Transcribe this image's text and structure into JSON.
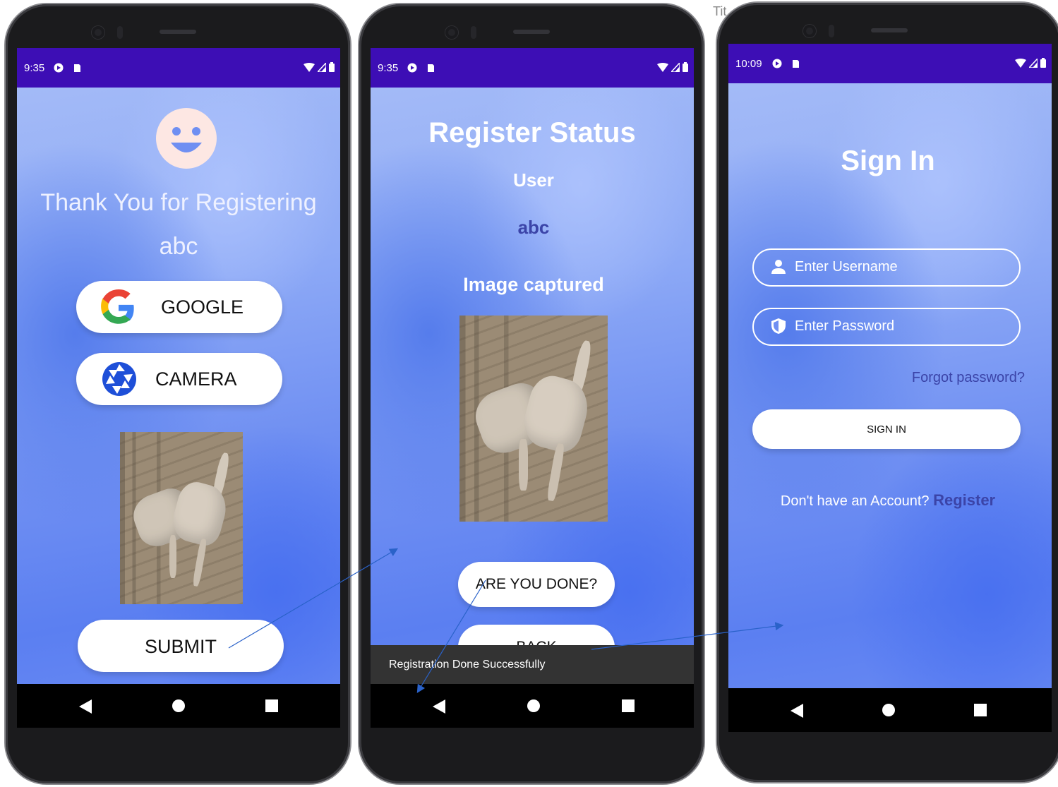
{
  "colors": {
    "status_bar": "#3d0eb5",
    "dark_accent": "#3b44a8",
    "pill_bg": "#ffffff",
    "snackbar_bg": "#333333"
  },
  "window_title_fragment": "Tit",
  "screen1": {
    "status": {
      "time": "9:35"
    },
    "smiley_icon": "smiley-face-icon",
    "thanks_text": "Thank You for Registering",
    "username": "abc",
    "google_button": "GOOGLE",
    "camera_button": "CAMERA",
    "submit_button": "SUBMIT"
  },
  "screen2": {
    "status": {
      "time": "9:35"
    },
    "title": "Register Status",
    "user_label": "User",
    "user_value": "abc",
    "image_label": "Image captured",
    "done_button": "ARE YOU DONE?",
    "back_button": "BACK",
    "snackbar": "Registration Done Successfully"
  },
  "screen3": {
    "status": {
      "time": "10:09"
    },
    "title": "Sign In",
    "username_placeholder": "Enter Username",
    "password_placeholder": "Enter Password",
    "forgot_password": "Forgot password?",
    "sign_in_button": "SIGN IN",
    "no_account": "Don't have an Account?",
    "register_link": "Register"
  }
}
